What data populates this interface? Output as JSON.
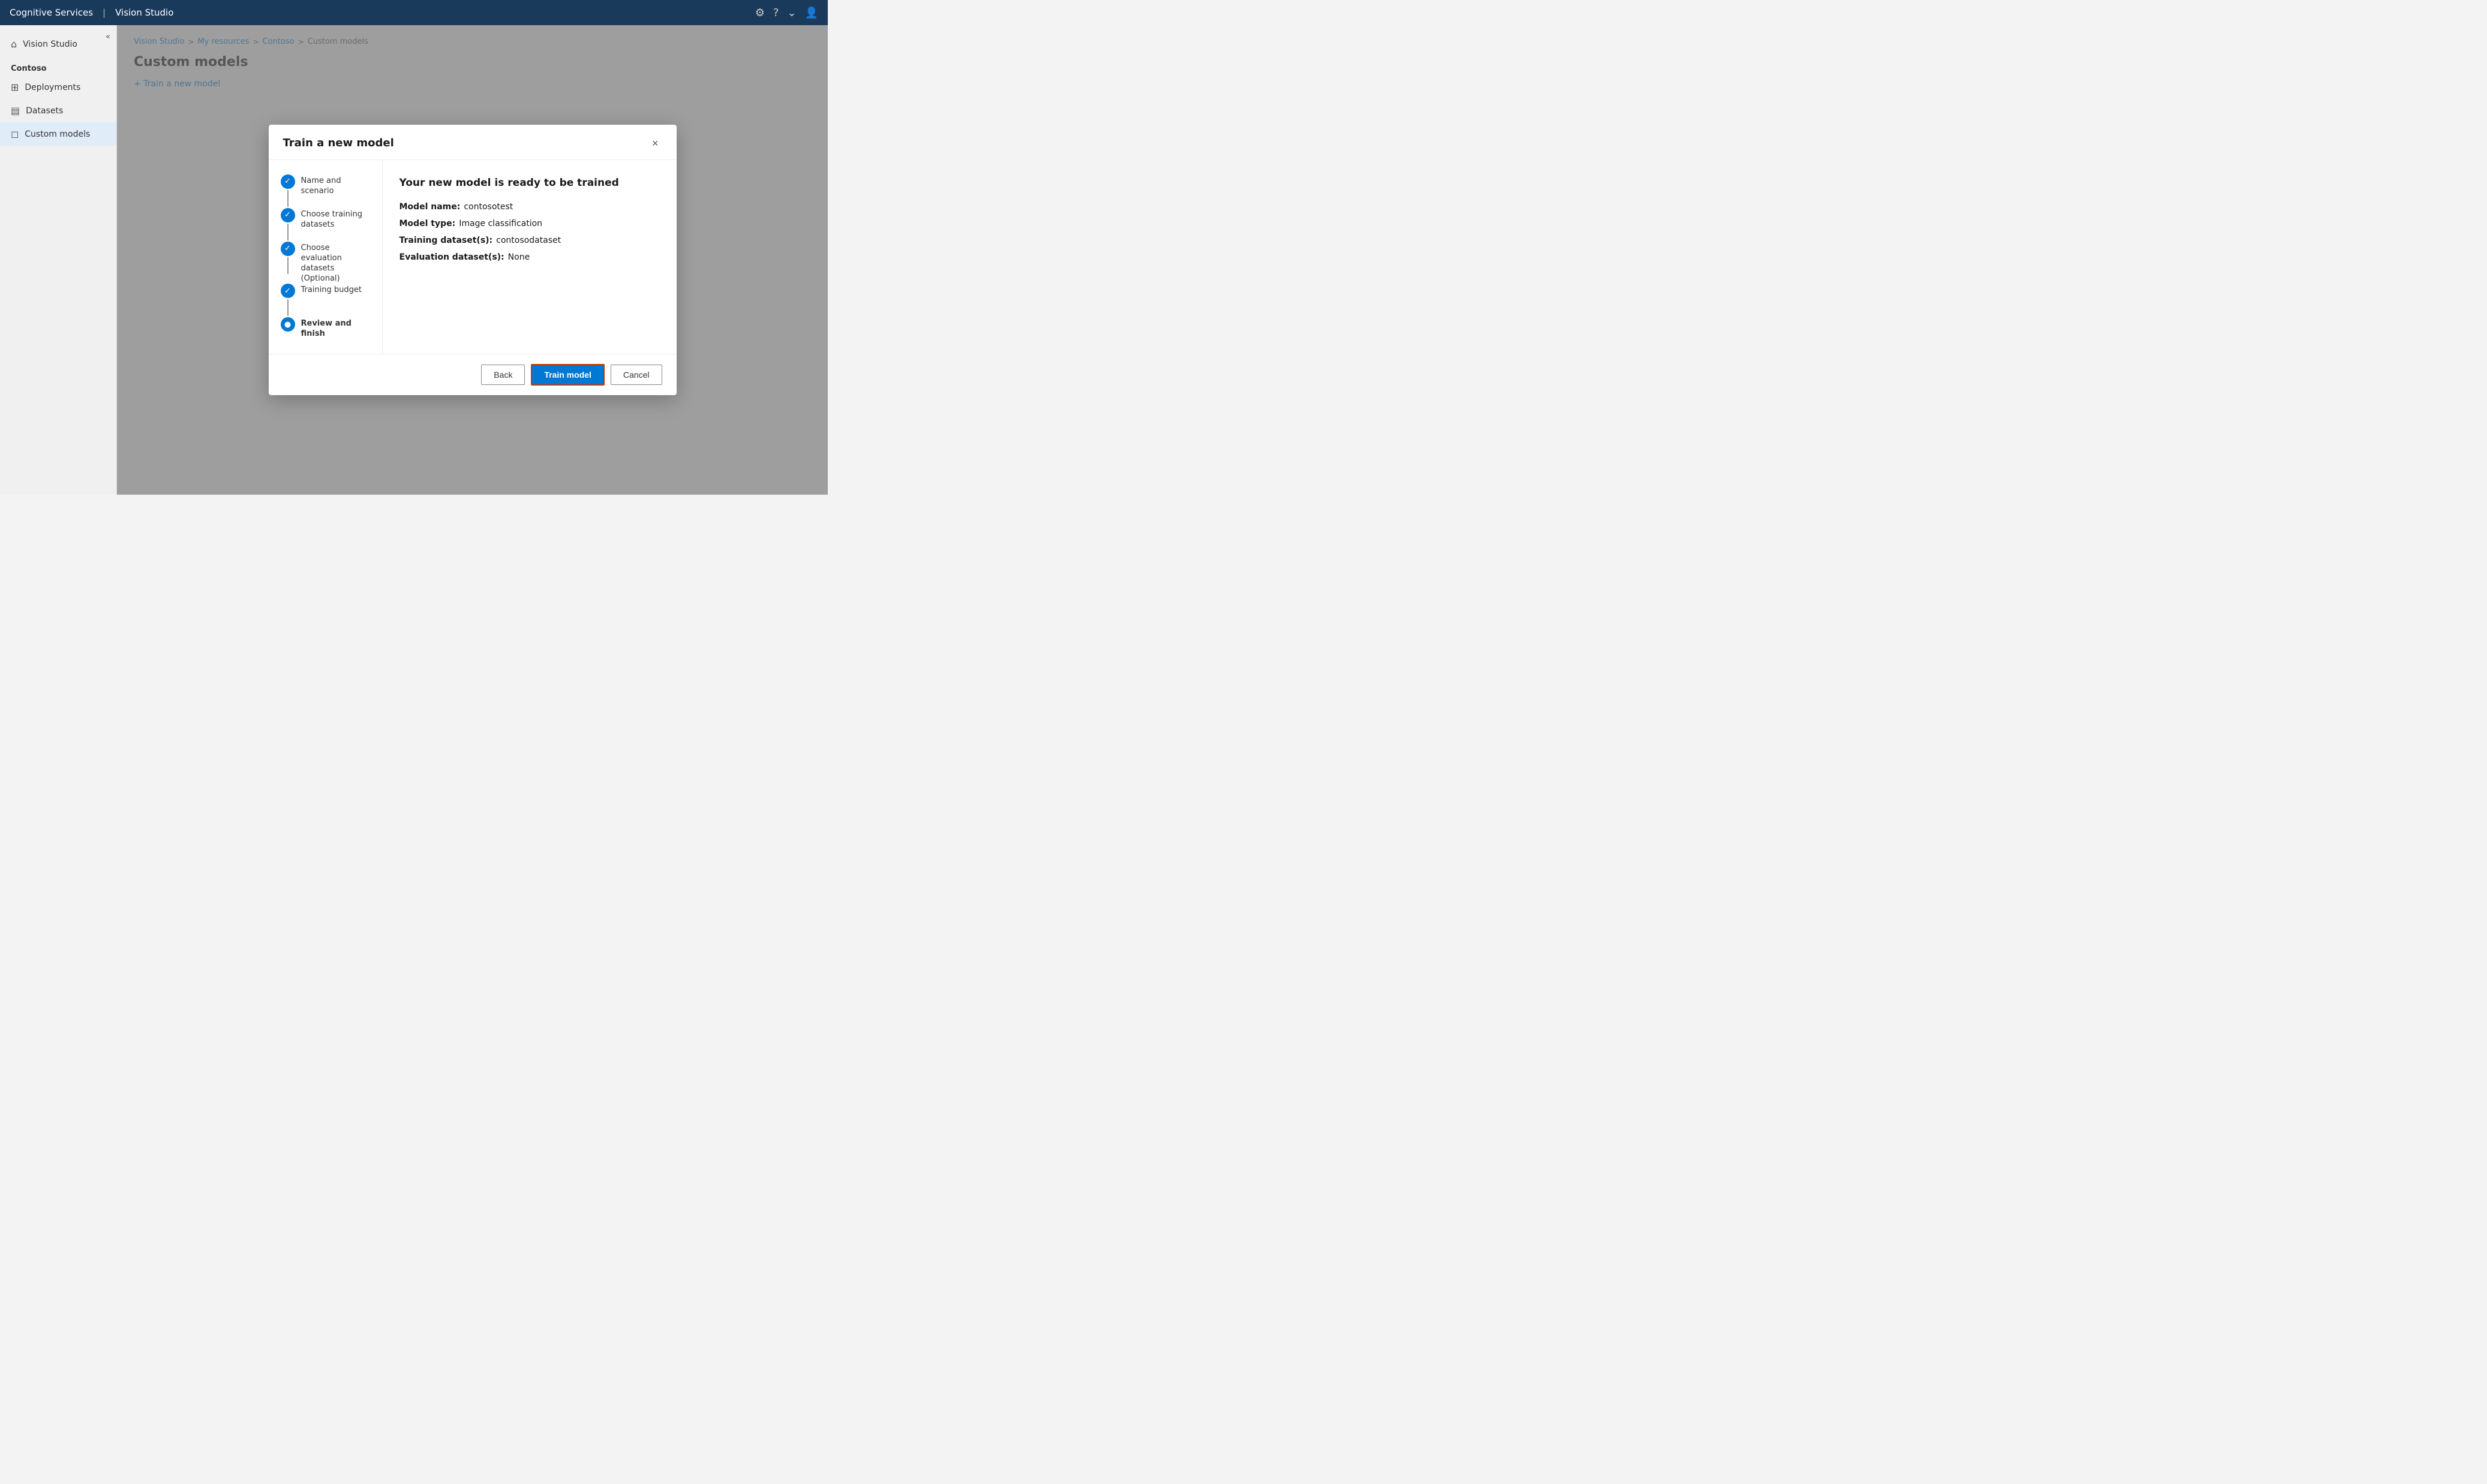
{
  "topbar": {
    "brand": "Cognitive Services",
    "divider": "|",
    "product": "Vision Studio",
    "icons": {
      "settings": "⚙",
      "help": "?",
      "dropdown": "⌄",
      "account": "👤"
    }
  },
  "sidebar": {
    "collapse_icon": "«",
    "nav_items": [
      {
        "id": "vision-studio",
        "label": "Vision Studio",
        "icon": "⌂",
        "active": false
      },
      {
        "id": "section-label",
        "label": "Contoso",
        "type": "section"
      },
      {
        "id": "deployments",
        "label": "Deployments",
        "icon": "⊞",
        "active": false
      },
      {
        "id": "datasets",
        "label": "Datasets",
        "icon": "▤",
        "active": false
      },
      {
        "id": "custom-models",
        "label": "Custom models",
        "icon": "◻",
        "active": true
      }
    ]
  },
  "breadcrumb": {
    "items": [
      {
        "label": "Vision Studio",
        "current": false
      },
      {
        "label": "My resources",
        "current": false
      },
      {
        "label": "Contoso",
        "current": false
      },
      {
        "label": "Custom models",
        "current": true
      }
    ],
    "separator": ">"
  },
  "page": {
    "title": "Custom models",
    "train_button_label": "+ Train a new model"
  },
  "modal": {
    "title": "Train a new model",
    "close_icon": "×",
    "steps": [
      {
        "id": "name-scenario",
        "label": "Name and scenario",
        "state": "completed"
      },
      {
        "id": "training-datasets",
        "label": "Choose training datasets",
        "state": "completed"
      },
      {
        "id": "eval-datasets",
        "label": "Choose evaluation datasets (Optional)",
        "state": "completed"
      },
      {
        "id": "training-budget",
        "label": "Training budget",
        "state": "completed"
      },
      {
        "id": "review-finish",
        "label": "Review and finish",
        "state": "active"
      }
    ],
    "content": {
      "title": "Your new model is ready to be trained",
      "fields": [
        {
          "label": "Model name:",
          "value": "contosotest"
        },
        {
          "label": "Model type:",
          "value": "Image classification"
        },
        {
          "label": "Training dataset(s):",
          "value": "contosodataset"
        },
        {
          "label": "Evaluation dataset(s):",
          "value": "None"
        }
      ]
    },
    "footer": {
      "back_label": "Back",
      "train_label": "Train model",
      "cancel_label": "Cancel"
    }
  }
}
